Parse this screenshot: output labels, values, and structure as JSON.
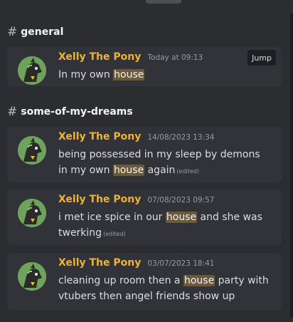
{
  "results": [
    {
      "channel": "general",
      "messages": [
        {
          "username": "Xelly The Pony",
          "timestamp": "Today at 09:13",
          "text_before": "In my own ",
          "highlight": "house",
          "text_after": "",
          "edited": "",
          "jump_label": "Jump"
        }
      ]
    },
    {
      "channel": "some-of-my-dreams",
      "messages": [
        {
          "username": "Xelly The Pony",
          "timestamp": "14/08/2023 13:34",
          "text_before": "being possessed in my sleep by demons in my own ",
          "highlight": "house",
          "text_after": " again",
          "edited": "(edited)"
        },
        {
          "username": "Xelly The Pony",
          "timestamp": "07/08/2023 09:57",
          "text_before": "i met ice spice in our ",
          "highlight": "house",
          "text_after": " and she was twerking",
          "edited": "(edited)"
        },
        {
          "username": "Xelly The Pony",
          "timestamp": "03/07/2023 18:41",
          "text_before": "cleaning up room then a ",
          "highlight": "house",
          "text_after": " party with vtubers then angel friends show up",
          "edited": ""
        }
      ]
    }
  ],
  "icons": {
    "channel": "hash-icon",
    "avatar": "pony-avatar-icon"
  },
  "colors": {
    "background": "#2b2d31",
    "card": "#313338",
    "username": "#f0b232",
    "highlight": "#6b5a3a"
  }
}
